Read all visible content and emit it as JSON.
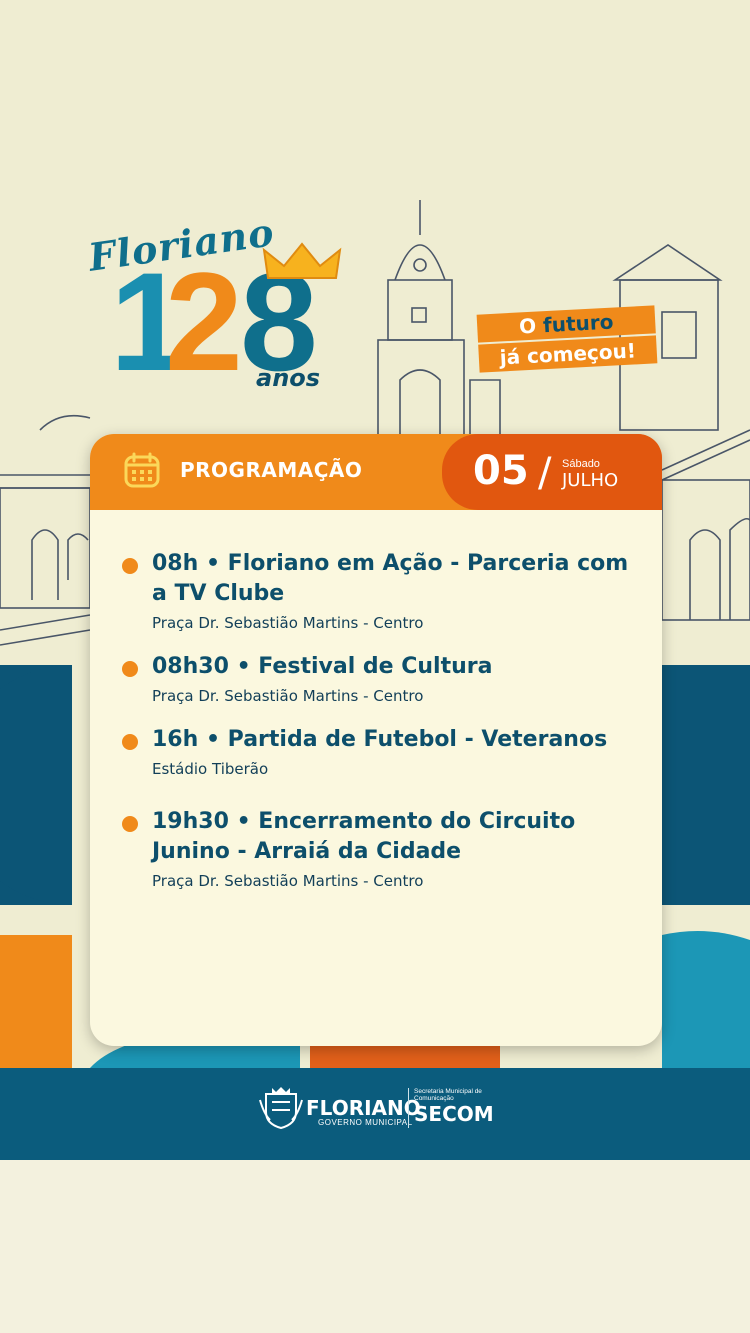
{
  "brand": {
    "script": "Floriano",
    "number_1": "1",
    "number_2": "2",
    "number_8": "8",
    "anos": "anos",
    "slogan_prefix": "O ",
    "slogan_bold": "futuro",
    "slogan_line2": "já começou!"
  },
  "card": {
    "header_label": "PROGRAMAÇÃO",
    "day": "05",
    "slash": "/",
    "weekday": "Sábado",
    "month": "JULHO"
  },
  "events": [
    {
      "time": "08h",
      "sep": " • ",
      "title": " Floriano em Ação - Parceria com a TV Clube",
      "place": "Praça Dr. Sebastião Martins - Centro"
    },
    {
      "time": "08h30",
      "sep": " • ",
      "title": "Festival de Cultura",
      "place": "Praça Dr. Sebastião Martins - Centro"
    },
    {
      "time": "16h",
      "sep": " • ",
      "title": "Partida de Futebol - Veteranos",
      "place": "Estádio Tiberão"
    },
    {
      "time": "19h30",
      "sep": " • ",
      "title": " Encerramento do Circuito Junino - Arraiá da Cidade",
      "place": "Praça Dr. Sebastião Martins - Centro"
    }
  ],
  "footer": {
    "floriano": "FLORIANO",
    "governo": "GOVERNO MUNICIPAL",
    "secretaria": "Secretaria Municipal de Comunicação",
    "secom": "SECOM"
  },
  "colors": {
    "orange": "#f08a1a",
    "dark_orange": "#e1570f",
    "navy": "#0d4f6b",
    "teal": "#0b5c7d",
    "cream": "#efedd2"
  }
}
